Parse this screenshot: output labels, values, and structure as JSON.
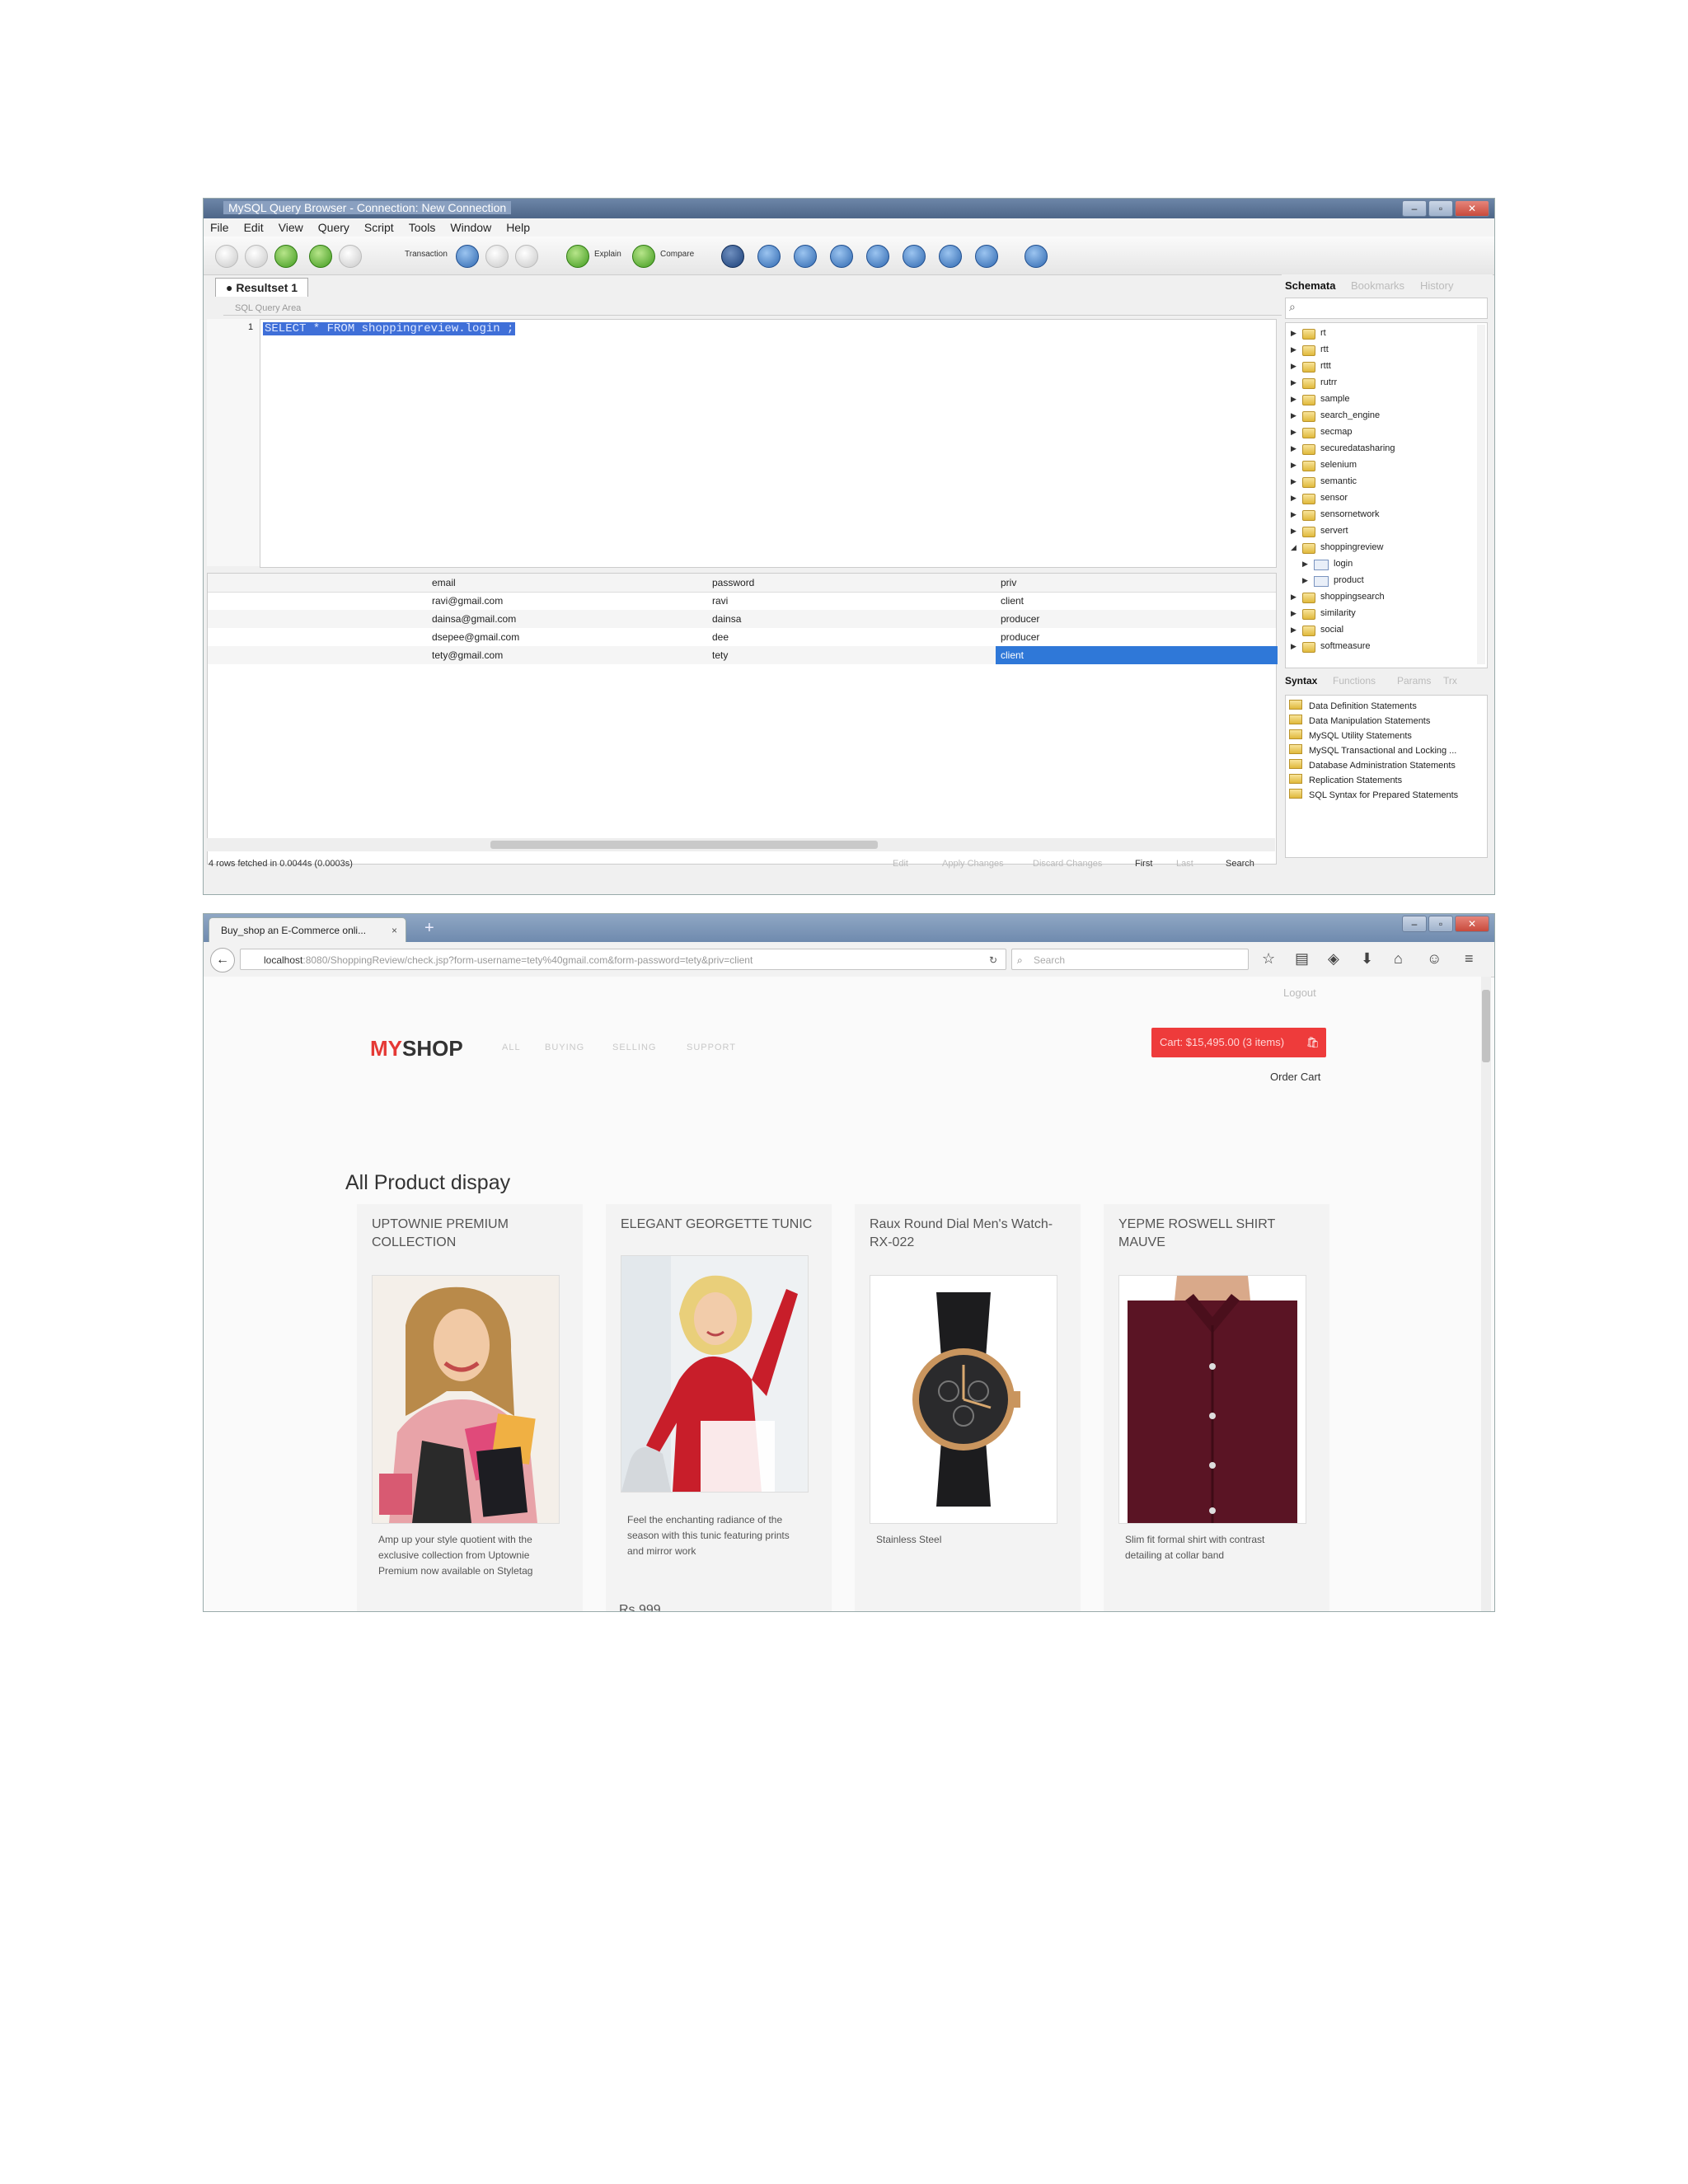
{
  "mysql": {
    "window_title": "MySQL Query Browser - Connection: New Connection",
    "menu": [
      "File",
      "Edit",
      "View",
      "Query",
      "Script",
      "Tools",
      "Window",
      "Help"
    ],
    "toolbar": {
      "transaction": "Transaction",
      "explain": "Explain",
      "compare": "Compare"
    },
    "result_tab": "Resultset 1",
    "query_area_label": "SQL Query Area",
    "line_number": "1",
    "sql": "SELECT * FROM shoppingreview.login ;",
    "columns": [
      "email",
      "password",
      "priv"
    ],
    "rows": [
      [
        "ravi@gmail.com",
        "ravi",
        "client"
      ],
      [
        "dainsa@gmail.com",
        "dainsa",
        "producer"
      ],
      [
        "dsepee@gmail.com",
        "dee",
        "producer"
      ],
      [
        "tety@gmail.com",
        "tety",
        "client"
      ]
    ],
    "status": "4 rows fetched in 0.0044s (0.0003s)",
    "status_buttons": {
      "edit": "Edit",
      "apply": "Apply Changes",
      "discard": "Discard Changes",
      "first": "First",
      "last": "Last",
      "search": "Search"
    },
    "right_tabs": [
      "Schemata",
      "Bookmarks",
      "History"
    ],
    "schemata": [
      {
        "name": "rt",
        "level": 0
      },
      {
        "name": "rtt",
        "level": 0
      },
      {
        "name": "rttt",
        "level": 0
      },
      {
        "name": "rutrr",
        "level": 0
      },
      {
        "name": "sample",
        "level": 0
      },
      {
        "name": "search_engine",
        "level": 0
      },
      {
        "name": "secmap",
        "level": 0
      },
      {
        "name": "securedatasharing",
        "level": 0
      },
      {
        "name": "selenium",
        "level": 0
      },
      {
        "name": "semantic",
        "level": 0
      },
      {
        "name": "sensor",
        "level": 0
      },
      {
        "name": "sensornetwork",
        "level": 0
      },
      {
        "name": "servert",
        "level": 0
      },
      {
        "name": "shoppingreview",
        "level": 0,
        "expanded": true
      },
      {
        "name": "login",
        "level": 1
      },
      {
        "name": "product",
        "level": 1
      },
      {
        "name": "shoppingsearch",
        "level": 0
      },
      {
        "name": "similarity",
        "level": 0
      },
      {
        "name": "social",
        "level": 0
      },
      {
        "name": "softmeasure",
        "level": 0
      }
    ],
    "syntax_tabs": [
      "Syntax",
      "Functions",
      "Params",
      "Trx"
    ],
    "syntax_items": [
      "Data Definition Statements",
      "Data Manipulation Statements",
      "MySQL Utility Statements",
      "MySQL Transactional and Locking ...",
      "Database Administration Statements",
      "Replication Statements",
      "SQL Syntax for Prepared Statements"
    ]
  },
  "browser": {
    "tab_title": "Buy_shop an E-Commerce onli...",
    "url_host": "localhost",
    "url_rest": ":8080/ShoppingReview/check.jsp?form-username=tety%40gmail.com&form-password=tety&priv=client",
    "search_placeholder": "Search",
    "logout": "Logout",
    "logo_my": "MY",
    "logo_shop": "SHOP",
    "nav": [
      "ALL",
      "BUYING",
      "SELLING",
      "SUPPORT"
    ],
    "cart": "Cart: $15,495.00 (3 items)",
    "order_cart": "Order Cart",
    "heading": "All Product dispay",
    "products": [
      {
        "title": "UPTOWNIE PREMIUM COLLECTION",
        "desc": "Amp up your style quotient with the exclusive collection from Uptownie Premium now available on Styletag",
        "price": ""
      },
      {
        "title": "ELEGANT GEORGETTE TUNIC",
        "desc": "Feel the enchanting radiance of the season with this tunic featuring prints and mirror work",
        "price": "Rs 999"
      },
      {
        "title": "Raux Round Dial Men's Watch-RX-022",
        "desc": "Stainless Steel",
        "price": ""
      },
      {
        "title": "YEPME ROSWELL SHIRT MAUVE",
        "desc": "Slim fit formal shirt with contrast detailing at collar band",
        "price": ""
      }
    ],
    "colors": {
      "accent": "#ee3b3b",
      "selection": "#2f78d8"
    }
  }
}
